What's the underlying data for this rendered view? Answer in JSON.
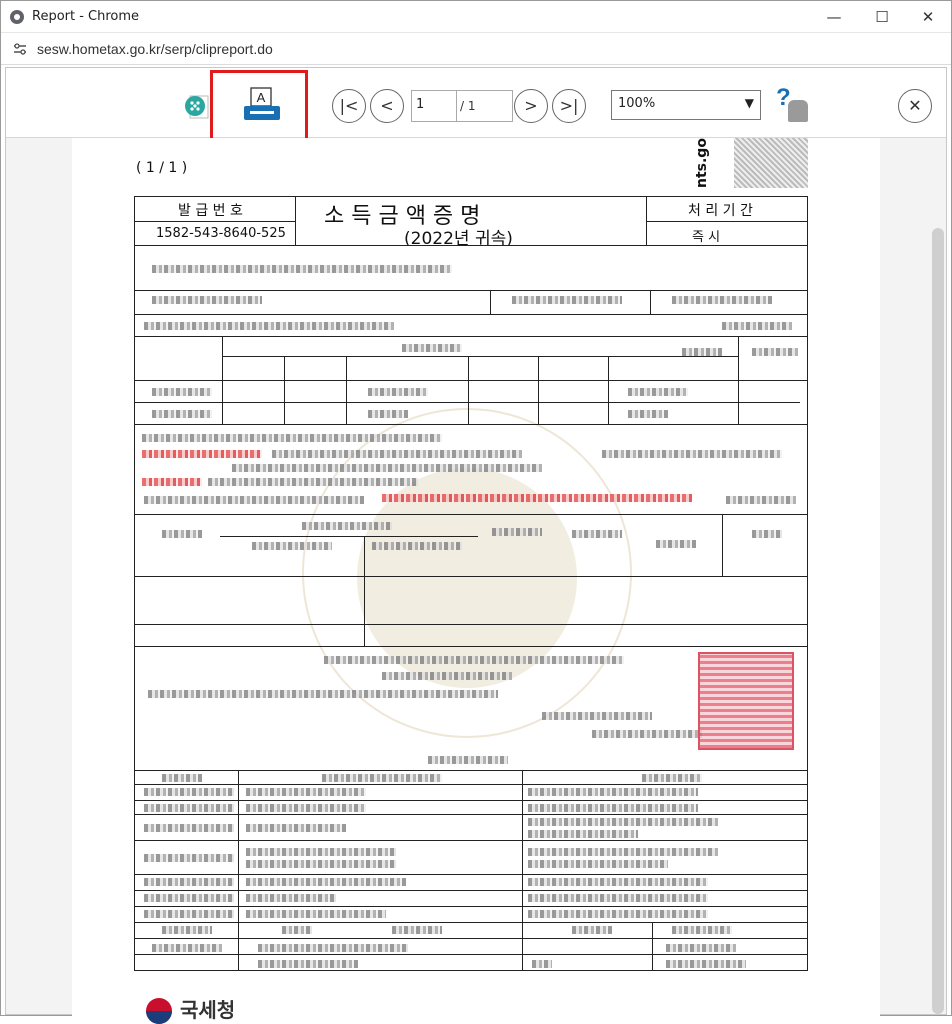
{
  "window": {
    "title": "Report - Chrome",
    "url": "sesw.hometax.go.kr/serp/clipreport.do"
  },
  "toolbar": {
    "first_glyph": "|<",
    "prev_glyph": "<",
    "next_glyph": ">",
    "last_glyph": ">|",
    "page_value": "1",
    "page_total": "/ 1",
    "zoom_value": "100%",
    "close_glyph": "✕",
    "help_glyph": "?"
  },
  "document": {
    "page_indicator": "( 1  /  1 )",
    "site_mark": "nts.go",
    "issue_number_label": "발 급 번 호",
    "issue_number": "1582-543-8640-525",
    "title": "소  득  금  액  증  명",
    "year": "(2022년 귀속)",
    "processing_label": "처 리 기 간",
    "processing_value": "즉     시",
    "footer_brand": "국세청"
  },
  "icons": {
    "accent": "#1a6fb3",
    "highlight": "#e01b1b",
    "stamp": "#d7374a"
  }
}
